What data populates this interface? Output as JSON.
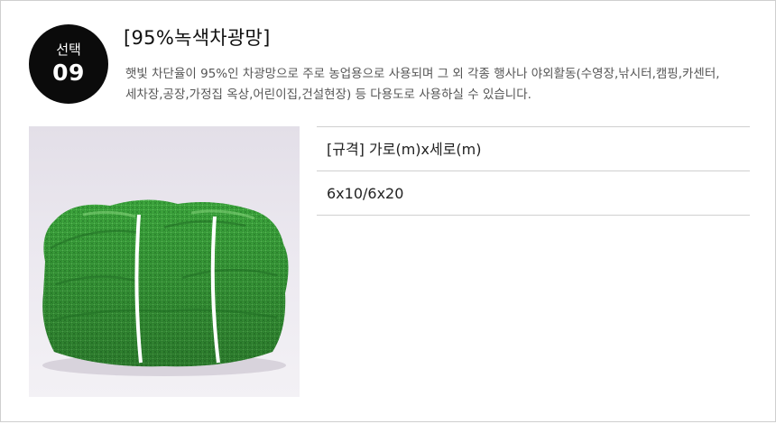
{
  "option": {
    "prefix": "선택",
    "number": "09"
  },
  "product": {
    "title": "[95%녹색차광망]",
    "description": "햇빛 차단율이 95%인 차광망으로 주로 농업용으로 사용되며 그 외 각종 행사나 야외활동(수영장,낚시터,캠핑,카센터,세차장,공장,가정집 옥상,어린이집,건설현장) 등 다용도로 사용하실 수 있습니다."
  },
  "image": {
    "icon": "green-shade-net-photo",
    "net_color": "#3aa23a",
    "background_color": "#eae6ef"
  },
  "spec": {
    "label": "[규격] 가로(m)x세로(m)",
    "value": "6x10/6x20"
  }
}
